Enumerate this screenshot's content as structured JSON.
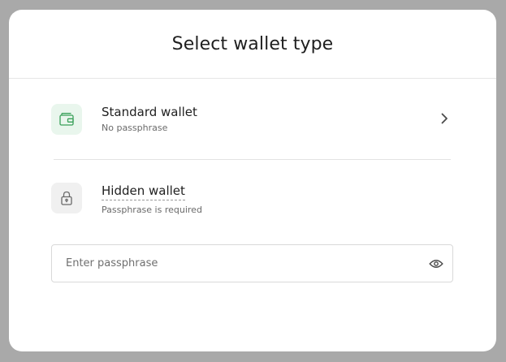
{
  "modal": {
    "title": "Select wallet type"
  },
  "options": [
    {
      "title": "Standard wallet",
      "subtitle": "No passphrase",
      "icon": "wallet-icon",
      "accent": "#3aa05a"
    },
    {
      "title": "Hidden wallet",
      "subtitle": "Passphrase is required",
      "icon": "lock-icon"
    }
  ],
  "passphrase": {
    "placeholder": "Enter passphrase",
    "value": "",
    "icon": "eye-icon"
  },
  "colors": {
    "backdrop": "#a9a9a9",
    "accent_green": "#3aa05a",
    "text": "#1f1f1f"
  }
}
